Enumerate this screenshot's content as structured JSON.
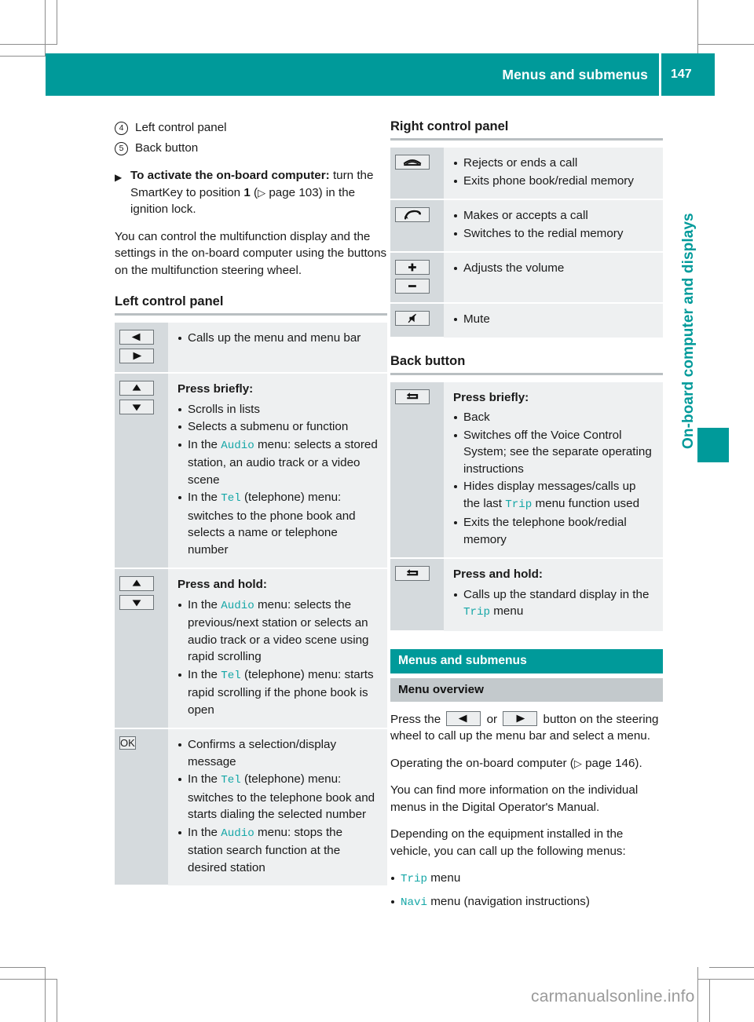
{
  "header": {
    "title": "Menus and submenus",
    "page_number": "147",
    "accent_color": "#009a9a"
  },
  "chapter_tab": {
    "label": "On-board computer and displays"
  },
  "watermark": "carmanualsonline.info",
  "left_column": {
    "callouts": [
      {
        "num": "4",
        "text": "Left control panel"
      },
      {
        "num": "5",
        "text": "Back button"
      }
    ],
    "instruction": {
      "mark": "▶",
      "bold": "To activate the on-board computer:",
      "rest_a": " turn the SmartKey to position ",
      "bold_b": "1",
      "rest_b": " (",
      "ref_arrow": "▷",
      "rest_c": " page 103) in the ignition lock."
    },
    "paragraph": "You can control the multifunction display and the settings in the on-board computer using the buttons on the multifunction steering wheel.",
    "section_title": "Left control panel",
    "rows": [
      {
        "icon": "left-right-arrow-keys",
        "header": "",
        "items": [
          {
            "text": "Calls up the menu and menu bar"
          }
        ]
      },
      {
        "icon": "up-down-arrow-keys",
        "header": "Press briefly:",
        "items": [
          {
            "text": "Scrolls in lists"
          },
          {
            "text": "Selects a submenu or function"
          },
          {
            "pre": "In the ",
            "code": "Audio",
            "post": " menu: selects a stored station, an audio track or a video scene"
          },
          {
            "pre": "In the ",
            "code": "Tel",
            "post": " (telephone) menu: switches to the phone book and selects a name or telephone number"
          }
        ]
      },
      {
        "icon": "up-down-arrow-keys",
        "header": "Press and hold:",
        "items": [
          {
            "pre": "In the ",
            "code": "Audio",
            "post": " menu: selects the previous/next station or selects an audio track or a video scene using rapid scrolling"
          },
          {
            "pre": "In the ",
            "code": "Tel",
            "post": " (telephone) menu: starts rapid scrolling if the phone book is open"
          }
        ]
      },
      {
        "icon": "ok-key",
        "icon_label": "OK",
        "header": "",
        "items": [
          {
            "text": "Confirms a selection/display message"
          },
          {
            "pre": "In the ",
            "code": "Tel",
            "post": " (telephone) menu: switches to the telephone book and starts dialing the selected number"
          },
          {
            "pre": "In the ",
            "code": "Audio",
            "post": " menu: stops the station search function at the desired station"
          }
        ]
      }
    ]
  },
  "right_column": {
    "section_title": "Right control panel",
    "rows": [
      {
        "icon": "end-call-key",
        "items": [
          {
            "text": "Rejects or ends a call"
          },
          {
            "text": "Exits phone book/redial memory"
          }
        ]
      },
      {
        "icon": "accept-call-key",
        "items": [
          {
            "text": "Makes or accepts a call"
          },
          {
            "text": "Switches to the redial memory"
          }
        ]
      },
      {
        "icon": "volume-plus-minus-keys",
        "items": [
          {
            "text": "Adjusts the volume"
          }
        ]
      },
      {
        "icon": "mute-key",
        "items": [
          {
            "text": "Mute"
          }
        ]
      }
    ],
    "back_section_title": "Back button",
    "back_rows": [
      {
        "icon": "back-key",
        "header": "Press briefly:",
        "items": [
          {
            "text": "Back"
          },
          {
            "text": "Switches off the Voice Control System; see the separate operating instructions"
          },
          {
            "pre": "Hides display messages/calls up the last ",
            "code": "Trip",
            "post": " menu function used"
          },
          {
            "text": "Exits the telephone book/redial memory"
          }
        ]
      },
      {
        "icon": "back-key",
        "header": "Press and hold:",
        "items": [
          {
            "pre": "Calls up the standard display in the ",
            "code": "Trip",
            "post": " menu"
          }
        ]
      }
    ],
    "teal_heading": "Menus and submenus",
    "gray_heading": "Menu overview",
    "para_1_a": "Press the ",
    "para_1_b": " or ",
    "para_1_c": " button on the steering wheel to call up the menu bar and select a menu.",
    "para_2_a": "Operating the on-board computer (",
    "para_2_arrow": "▷",
    "para_2_b": " page 146).",
    "para_3": "You can find more information on the individual menus in the Digital Operator's Manual.",
    "para_4": "Depending on the equipment installed in the vehicle, you can call up the following menus:",
    "menu_list": [
      {
        "code": "Trip",
        "post": " menu"
      },
      {
        "code": "Navi",
        "post": " menu (navigation instructions)"
      }
    ]
  }
}
